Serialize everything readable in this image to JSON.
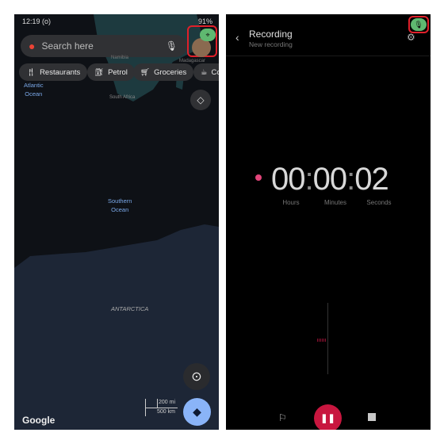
{
  "maps": {
    "status": {
      "time": "12:19",
      "extra": "(o)",
      "battery": "91%"
    },
    "search_placeholder": "Search here",
    "chips": [
      {
        "label": "Restaurants",
        "icon": "fork-knife-icon"
      },
      {
        "label": "Petrol",
        "icon": "fuel-icon"
      },
      {
        "label": "Groceries",
        "icon": "cart-icon"
      },
      {
        "label": "Co",
        "icon": "coffee-icon"
      }
    ],
    "labels": {
      "atlantic": "Atlantic",
      "ocean": "Ocean",
      "namibia": "Namibia",
      "madagascar": "Madagascar",
      "south_africa": "South Africa",
      "southern": "Southern",
      "southern_ocean": "Ocean",
      "antarctica": "ANTARCTICA"
    },
    "scale": {
      "mi": "200 mi",
      "km": "500 km"
    },
    "logo": "Google",
    "colors": {
      "directions": "#8ab4f8",
      "location_badge": "#5fb870",
      "highlight": "#e0202a"
    }
  },
  "recorder": {
    "title": "Recording",
    "subtitle": "New recording",
    "time": {
      "h": "00",
      "m": "00",
      "s": "02"
    },
    "units": {
      "h": "Hours",
      "m": "Minutes",
      "s": "Seconds"
    },
    "colors": {
      "accent": "#c8163f",
      "mic_badge": "#5fb870"
    }
  }
}
